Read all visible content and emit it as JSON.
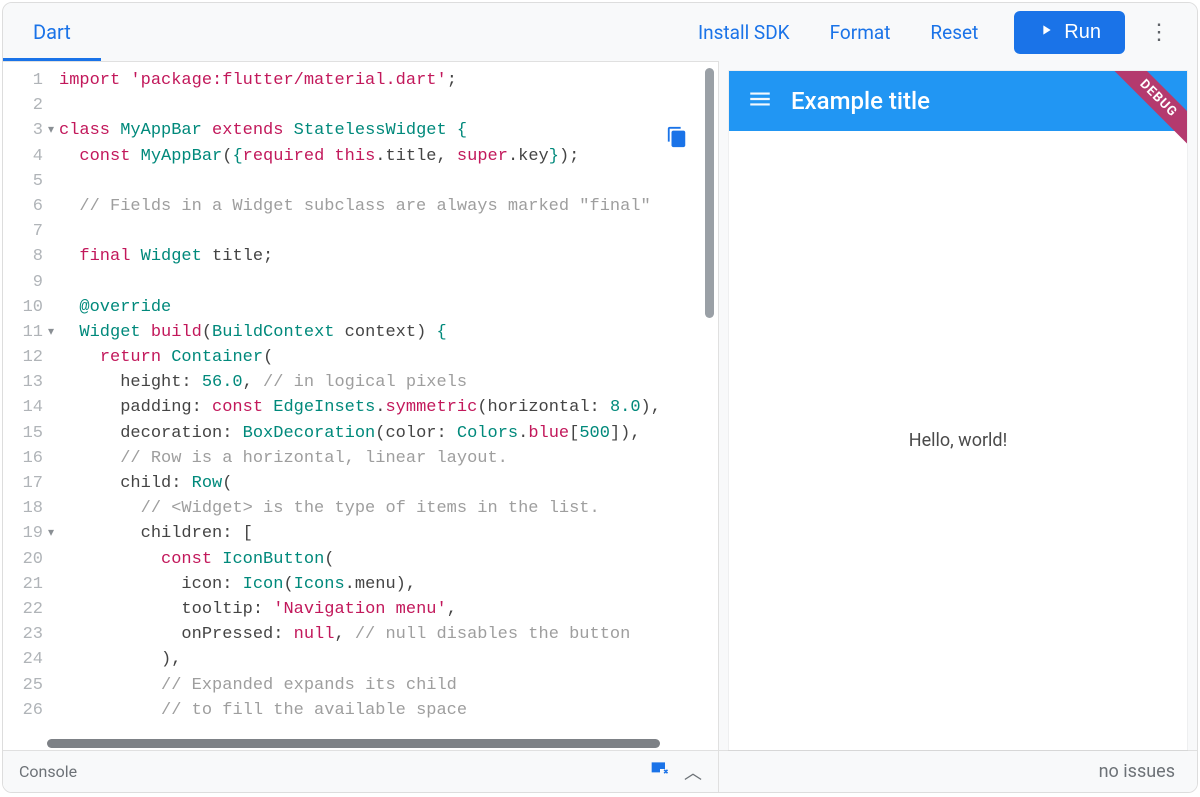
{
  "toolbar": {
    "tab_label": "Dart",
    "install_sdk": "Install SDK",
    "format": "Format",
    "reset": "Reset",
    "run": "Run"
  },
  "editor": {
    "line_numbers": [
      "1",
      "2",
      "3",
      "4",
      "5",
      "6",
      "7",
      "8",
      "9",
      "10",
      "11",
      "12",
      "13",
      "14",
      "15",
      "16",
      "17",
      "18",
      "19",
      "20",
      "21",
      "22",
      "23",
      "24",
      "25",
      "26"
    ],
    "fold_lines": [
      3,
      11,
      19
    ],
    "code_lines": [
      [
        [
          "kw",
          "import"
        ],
        [
          "pl",
          " "
        ],
        [
          "str",
          "'package:flutter/material.dart'"
        ],
        [
          "pl",
          ";"
        ]
      ],
      [],
      [
        [
          "kw",
          "class"
        ],
        [
          "pl",
          " "
        ],
        [
          "type",
          "MyAppBar"
        ],
        [
          "pl",
          " "
        ],
        [
          "kw",
          "extends"
        ],
        [
          "pl",
          " "
        ],
        [
          "type",
          "StatelessWidget"
        ],
        [
          "pl",
          " "
        ],
        [
          "br",
          "{"
        ]
      ],
      [
        [
          "pl",
          "  "
        ],
        [
          "kw",
          "const"
        ],
        [
          "pl",
          " "
        ],
        [
          "type",
          "MyAppBar"
        ],
        [
          "pl",
          "("
        ],
        [
          "br",
          "{"
        ],
        [
          "kw",
          "required"
        ],
        [
          "pl",
          " "
        ],
        [
          "kw",
          "this"
        ],
        [
          "pl",
          "."
        ],
        [
          "pl",
          "title"
        ],
        [
          "pl",
          ", "
        ],
        [
          "kw",
          "super"
        ],
        [
          "pl",
          "."
        ],
        [
          "pl",
          "key"
        ],
        [
          "br",
          "}"
        ],
        [
          "pl",
          ")"
        ],
        [
          "pl",
          ";"
        ]
      ],
      [],
      [
        [
          "pl",
          "  "
        ],
        [
          "com",
          "// Fields in a Widget subclass are always marked \"final\""
        ]
      ],
      [],
      [
        [
          "pl",
          "  "
        ],
        [
          "kw",
          "final"
        ],
        [
          "pl",
          " "
        ],
        [
          "type",
          "Widget"
        ],
        [
          "pl",
          " title;"
        ]
      ],
      [],
      [
        [
          "pl",
          "  "
        ],
        [
          "ann",
          "@override"
        ]
      ],
      [
        [
          "pl",
          "  "
        ],
        [
          "type",
          "Widget"
        ],
        [
          "pl",
          " "
        ],
        [
          "fn",
          "build"
        ],
        [
          "pl",
          "("
        ],
        [
          "type",
          "BuildContext"
        ],
        [
          "pl",
          " context) "
        ],
        [
          "br",
          "{"
        ]
      ],
      [
        [
          "pl",
          "    "
        ],
        [
          "kw",
          "return"
        ],
        [
          "pl",
          " "
        ],
        [
          "type",
          "Container"
        ],
        [
          "pl",
          "("
        ]
      ],
      [
        [
          "pl",
          "      height: "
        ],
        [
          "num",
          "56.0"
        ],
        [
          "pl",
          ", "
        ],
        [
          "com",
          "// in logical pixels"
        ]
      ],
      [
        [
          "pl",
          "      padding: "
        ],
        [
          "kw",
          "const"
        ],
        [
          "pl",
          " "
        ],
        [
          "type",
          "EdgeInsets"
        ],
        [
          "pl",
          "."
        ],
        [
          "fn",
          "symmetric"
        ],
        [
          "pl",
          "(horizontal: "
        ],
        [
          "num",
          "8.0"
        ],
        [
          "pl",
          "),"
        ]
      ],
      [
        [
          "pl",
          "      decoration: "
        ],
        [
          "type",
          "BoxDecoration"
        ],
        [
          "pl",
          "(color: "
        ],
        [
          "type",
          "Colors"
        ],
        [
          "pl",
          "."
        ],
        [
          "fn",
          "blue"
        ],
        [
          "pl",
          "["
        ],
        [
          "num",
          "500"
        ],
        [
          "pl",
          "]),"
        ]
      ],
      [
        [
          "pl",
          "      "
        ],
        [
          "com",
          "// Row is a horizontal, linear layout."
        ]
      ],
      [
        [
          "pl",
          "      child: "
        ],
        [
          "type",
          "Row"
        ],
        [
          "pl",
          "("
        ]
      ],
      [
        [
          "pl",
          "        "
        ],
        [
          "com",
          "// <Widget> is the type of items in the list."
        ]
      ],
      [
        [
          "pl",
          "        children: ["
        ]
      ],
      [
        [
          "pl",
          "          "
        ],
        [
          "kw",
          "const"
        ],
        [
          "pl",
          " "
        ],
        [
          "type",
          "IconButton"
        ],
        [
          "pl",
          "("
        ]
      ],
      [
        [
          "pl",
          "            icon: "
        ],
        [
          "type",
          "Icon"
        ],
        [
          "pl",
          "("
        ],
        [
          "type",
          "Icons"
        ],
        [
          "pl",
          ".menu),"
        ]
      ],
      [
        [
          "pl",
          "            tooltip: "
        ],
        [
          "str",
          "'Navigation menu'"
        ],
        [
          "pl",
          ","
        ]
      ],
      [
        [
          "pl",
          "            onPressed: "
        ],
        [
          "kw",
          "null"
        ],
        [
          "pl",
          ", "
        ],
        [
          "com",
          "// null disables the button"
        ]
      ],
      [
        [
          "pl",
          "          ),"
        ]
      ],
      [
        [
          "pl",
          "          "
        ],
        [
          "com",
          "// Expanded expands its child"
        ]
      ],
      [
        [
          "pl",
          "          "
        ],
        [
          "com",
          "// to fill the available space"
        ]
      ]
    ]
  },
  "console": {
    "label": "Console"
  },
  "preview": {
    "appbar_title": "Example title",
    "body_text": "Hello, world!",
    "debug_label": "DEBUG",
    "status": "no issues"
  }
}
